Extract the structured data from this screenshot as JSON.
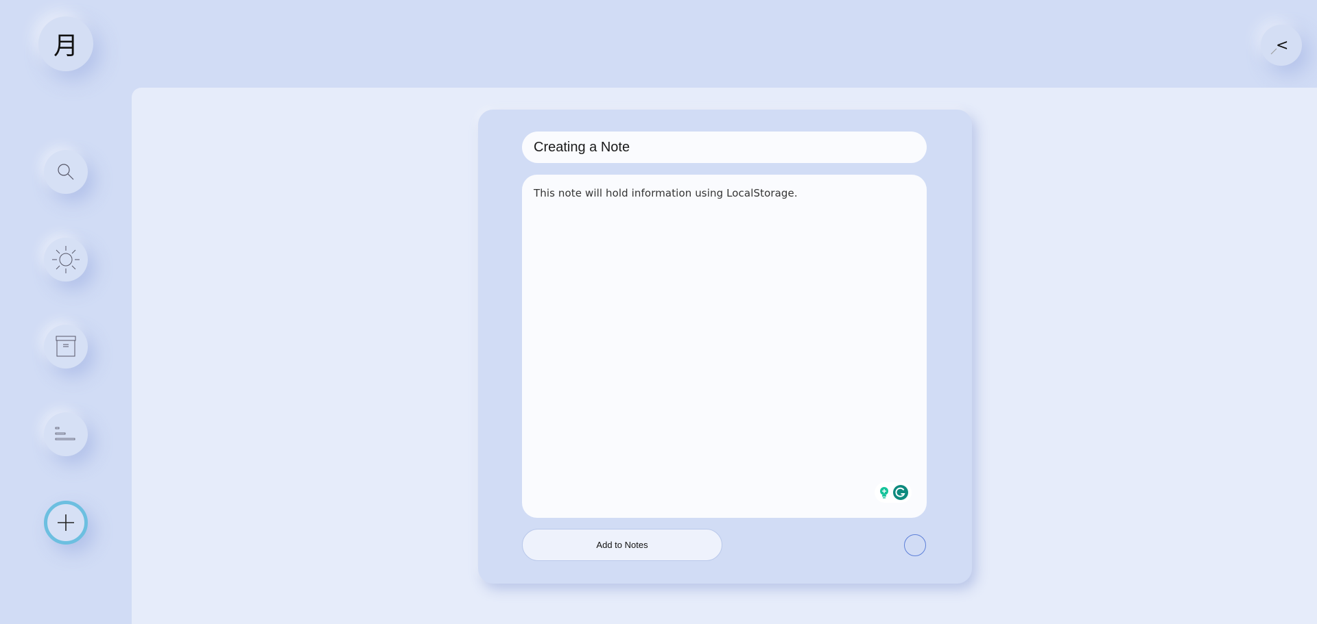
{
  "app": {
    "logo_glyph": "月"
  },
  "header": {
    "collapse_glyph": "<"
  },
  "sidebar": {
    "items": [
      {
        "name": "search",
        "icon": "search-icon"
      },
      {
        "name": "theme",
        "icon": "sun-icon"
      },
      {
        "name": "archive",
        "icon": "archive-icon"
      },
      {
        "name": "list",
        "icon": "list-icon"
      }
    ],
    "add": {
      "icon": "plus-icon"
    }
  },
  "note": {
    "title_value": "Creating a Note",
    "body_value": "This note will hold information using LocalStorage.",
    "add_button_label": "Add to Notes"
  },
  "colors": {
    "background": "#d1dcf5",
    "main_panel": "#e6ecfa",
    "card": "#d1dcf5",
    "input": "#fafbfe",
    "add_ring": "#6cbfe0",
    "color_picker_border": "#5c7fd8",
    "grammarly_green": "#15c39a",
    "grammarly_teal": "#0e8a7e"
  }
}
